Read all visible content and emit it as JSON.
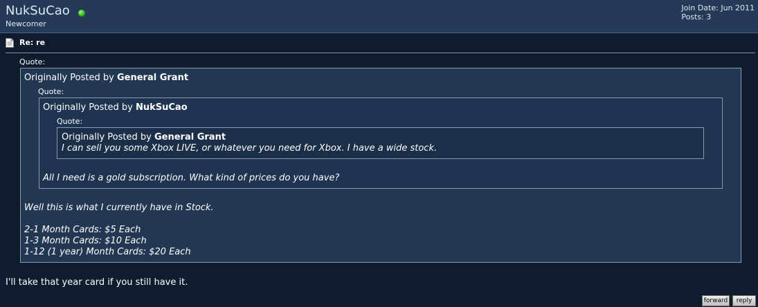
{
  "user": {
    "name": "NukSuCao",
    "rank": "Newcomer",
    "join_date": "Join Date: Jun 2011",
    "posts": "Posts: 3",
    "online_color": "#3fc12a"
  },
  "post": {
    "title": "Re: re",
    "reply_text": "I'll take that year card if you still have it."
  },
  "quotes": {
    "label": "Quote:",
    "originally_posted_by": "Originally Posted by",
    "outer": {
      "author": "General Grant",
      "lines": [
        "Well this is what I currently have in Stock.",
        "2-1 Month Cards: $5 Each",
        "1-3 Month Cards: $10 Each",
        "1-12 (1 year) Month Cards: $20 Each"
      ]
    },
    "middle": {
      "author": "NukSuCao",
      "text": "All I need is a gold subscription. What kind of prices do you have?"
    },
    "inner": {
      "author": "General Grant",
      "text": "I can sell you some Xbox LIVE, or whatever you need for Xbox. I have a wide stock."
    }
  },
  "buttons": {
    "forward": "forward",
    "reply": "reply"
  }
}
